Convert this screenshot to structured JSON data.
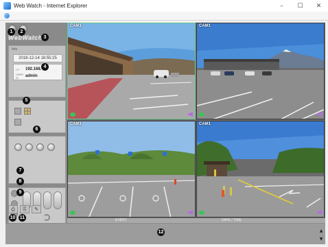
{
  "window": {
    "title": "Web Watch - Internet Explorer",
    "minimize": "–",
    "maximize": "☐",
    "close": "✕"
  },
  "sidebar": {
    "brand": "WebWatch",
    "info_label": "Info",
    "datetime": "2018-12-14 16:55:25",
    "ip_key": "I.P.",
    "ip_value": "192.168.",
    "user_key": "USER ID",
    "user_value": "admin"
  },
  "cameras": [
    {
      "label": "CAM1"
    },
    {
      "label": "CAM1"
    },
    {
      "label": "CAM1"
    },
    {
      "label": "CAM1"
    }
  ],
  "event_panel": {
    "event_header": "EVENT",
    "date_header": "DATE / TIME",
    "scroll_up": "▲",
    "scroll_down": "▼"
  },
  "callouts": [
    "1",
    "2",
    "3",
    "4",
    "5",
    "6",
    "7",
    "8",
    "9",
    "10",
    "11",
    "12"
  ],
  "colors": {
    "active_camera_border": "#62c88a",
    "panel_gray": "#8a8a8a",
    "callout_bg": "#111111"
  }
}
